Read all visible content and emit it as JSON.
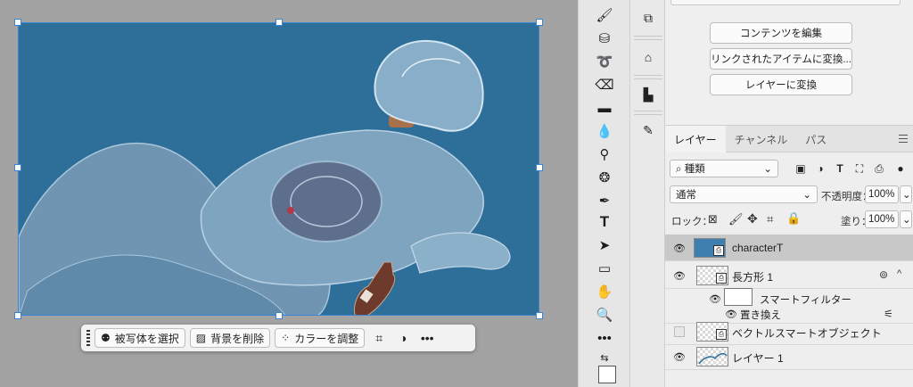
{
  "taskbar": {
    "select_subject": "被写体を選択",
    "remove_background": "背景を削除",
    "adjust_color": "カラーを調整"
  },
  "properties": {
    "edit_contents": "コンテンツを編集",
    "convert_to_linked": "リンクされたアイテムに変換...",
    "convert_to_layers": "レイヤーに変換"
  },
  "layers_panel": {
    "tabs": [
      "レイヤー",
      "チャンネル",
      "パス"
    ],
    "filter_kind": "種類",
    "blend_mode": "通常",
    "opacity_label": "不透明度：",
    "opacity_value": "100%",
    "lock_label": "ロック：",
    "fill_label": "塗り：",
    "fill_value": "100%",
    "layers": [
      {
        "name": "characterT",
        "visible": true,
        "selected": true
      },
      {
        "name": "長方形 1",
        "visible": true,
        "selected": false
      },
      {
        "name": "スマートフィルター",
        "visible": true,
        "sub": true
      },
      {
        "name": "置き換え",
        "visible": true,
        "sub": true
      },
      {
        "name": "ベクトルスマートオブジェクト",
        "visible": false,
        "selected": false
      },
      {
        "name": "レイヤー 1",
        "visible": true,
        "selected": false
      }
    ]
  },
  "colors": {
    "canvas_blue": "#2e6f9a",
    "selection": "#3a84d6",
    "workspace": "#a3a3a3",
    "panel": "#eeeeee"
  }
}
